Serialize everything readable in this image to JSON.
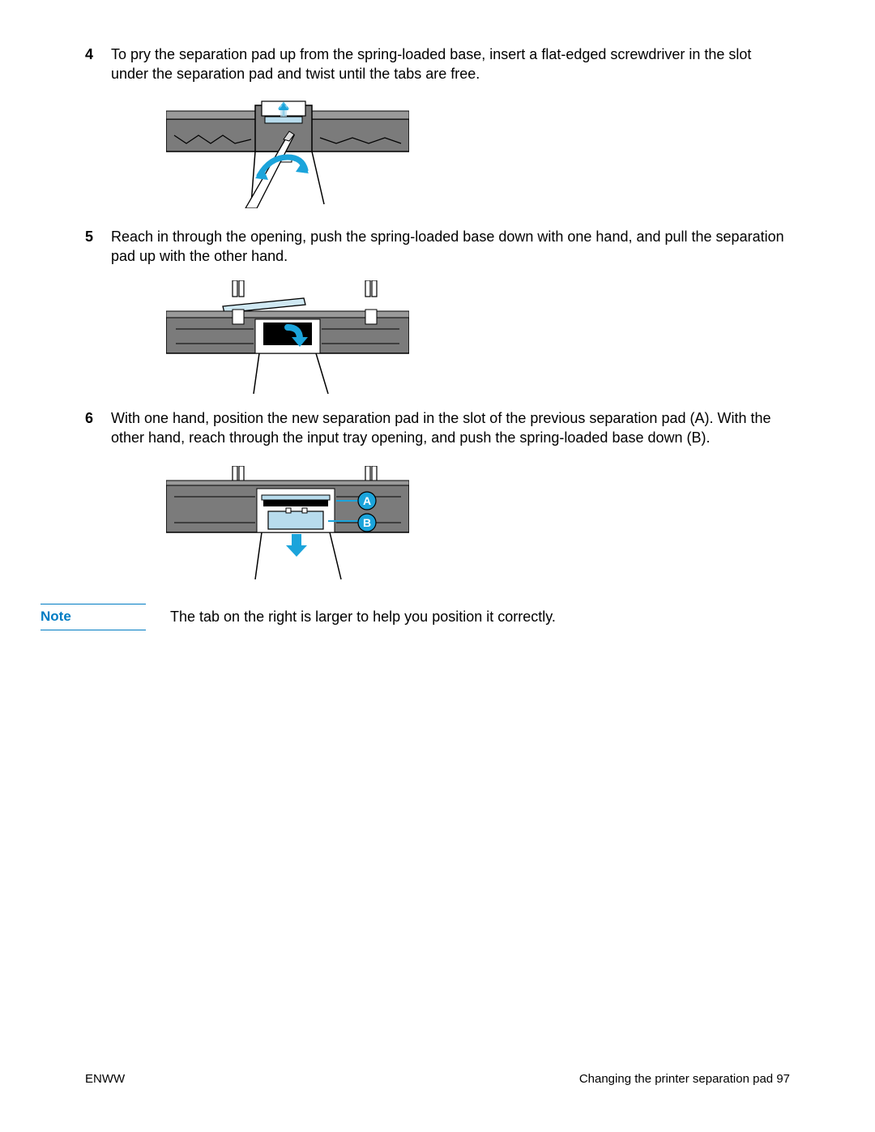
{
  "steps": [
    {
      "num": "4",
      "text": "To pry the separation pad up from the spring-loaded base, insert a flat-edged screwdriver in the slot under the separation pad and twist until the tabs are free."
    },
    {
      "num": "5",
      "text": "Reach in through the opening, push the spring-loaded base down with one hand, and pull the separation pad up with the other hand."
    },
    {
      "num": "6",
      "text": "With one hand, position the new separation pad in the slot of the previous separation pad (A). With the other hand, reach through the input tray opening, and push the spring-loaded base down (B)."
    }
  ],
  "labels": {
    "A": "A",
    "B": "B"
  },
  "note": {
    "label": "Note",
    "text": "The tab on the right is larger to help you position it correctly."
  },
  "footer": {
    "left": "ENWW",
    "right": "Changing the printer separation pad 97"
  },
  "colors": {
    "accent": "#007cc3",
    "arrow": "#1ba4db",
    "light": "#b8dced",
    "gray_dark": "#7b7b7b",
    "gray_med": "#9a9a9a"
  }
}
